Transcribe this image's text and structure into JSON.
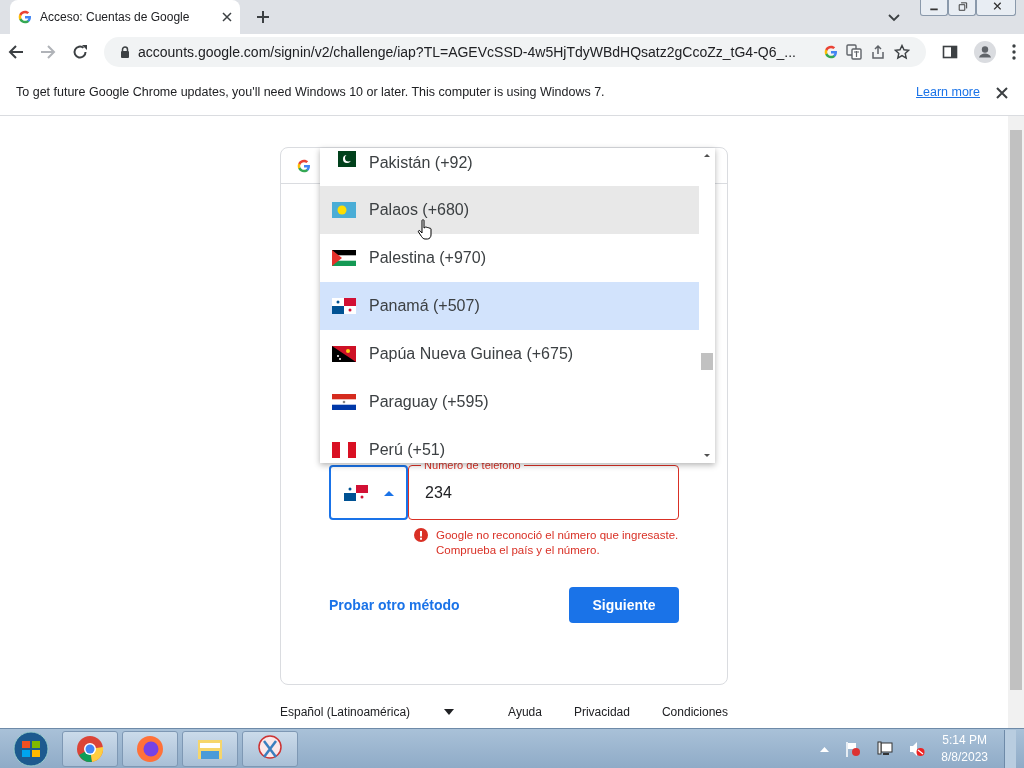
{
  "browser": {
    "tab_title": "Acceso: Cuentas de Google",
    "address": "accounts.google.com/signin/v2/challenge/iap?TL=AGEVcSSD-4w5HjTdyWBdHQsatz2gCcoZz_tG4-Q6_...",
    "infobar": {
      "message": "To get future Google Chrome updates, you'll need Windows 10 or later. This computer is using Windows 7.",
      "link": "Learn more"
    }
  },
  "country_dropdown": {
    "items": [
      {
        "kind": "pakistan",
        "label": "Pakistán (+92)",
        "selected": false,
        "hovered": false
      },
      {
        "kind": "palau",
        "label": "Palaos (+680)",
        "selected": false,
        "hovered": true
      },
      {
        "kind": "palestine",
        "label": "Palestina (+970)",
        "selected": false,
        "hovered": false
      },
      {
        "kind": "panama",
        "label": "Panamá (+507)",
        "selected": true,
        "hovered": false
      },
      {
        "kind": "png",
        "label": "Papúa Nueva Guinea (+675)",
        "selected": false,
        "hovered": false
      },
      {
        "kind": "paraguay",
        "label": "Paraguay (+595)",
        "selected": false,
        "hovered": false
      },
      {
        "kind": "peru",
        "label": "Perú (+51)",
        "selected": false,
        "hovered": false
      }
    ]
  },
  "phone": {
    "label": "Número de teléfono",
    "value": "234",
    "error": "Google no reconoció el número que ingresaste. Comprueba el país y el número."
  },
  "actions": {
    "link": "Probar otro método",
    "button": "Siguiente"
  },
  "footer": {
    "language": "Español (Latinoamérica)",
    "links": [
      "Ayuda",
      "Privacidad",
      "Condiciones"
    ]
  },
  "taskbar": {
    "time": "5:14 PM",
    "date": "8/8/2023"
  }
}
